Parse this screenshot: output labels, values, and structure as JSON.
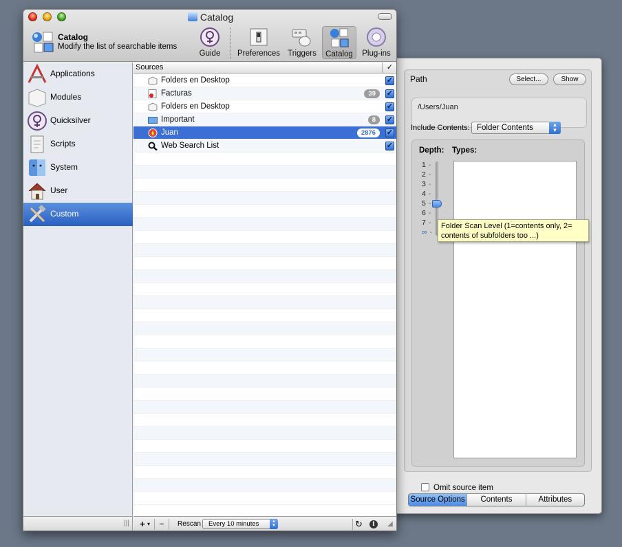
{
  "window": {
    "title": "Catalog"
  },
  "header": {
    "title": "Catalog",
    "subtitle": "Modify the list of searchable items"
  },
  "toolbar": [
    {
      "id": "guide",
      "label": "Guide",
      "icon": "guide-icon"
    },
    {
      "id": "preferences",
      "label": "Preferences",
      "icon": "switch-icon"
    },
    {
      "id": "triggers",
      "label": "Triggers",
      "icon": "keyboard-mouse-icon"
    },
    {
      "id": "catalog",
      "label": "Catalog",
      "icon": "catalog-icon",
      "selected": true
    },
    {
      "id": "plugins",
      "label": "Plug-ins",
      "icon": "puzzle-icon"
    }
  ],
  "sidebar": {
    "items": [
      {
        "label": "Applications",
        "icon": "applications-icon"
      },
      {
        "label": "Modules",
        "icon": "modules-icon"
      },
      {
        "label": "Quicksilver",
        "icon": "quicksilver-icon"
      },
      {
        "label": "Scripts",
        "icon": "scripts-icon"
      },
      {
        "label": "System",
        "icon": "finder-icon"
      },
      {
        "label": "User",
        "icon": "home-icon"
      },
      {
        "label": "Custom",
        "icon": "tools-icon",
        "selected": true
      }
    ]
  },
  "sources": {
    "header": "Sources",
    "check_header": "✓",
    "rows": [
      {
        "name": "Folders en Desktop",
        "count": "",
        "icon": "folder-box-icon"
      },
      {
        "name": "Facturas",
        "count": "39",
        "icon": "document-icon"
      },
      {
        "name": "Folders en Desktop",
        "count": "",
        "icon": "folder-box-icon"
      },
      {
        "name": "Important",
        "count": "8",
        "icon": "folder-blue-icon"
      },
      {
        "name": "Juan",
        "count": "2876",
        "icon": "user-folder-icon",
        "selected": true
      },
      {
        "name": "Web Search List",
        "count": "",
        "icon": "magnifier-icon"
      }
    ]
  },
  "bottom_bar": {
    "add": "+",
    "add_menu": "▾",
    "remove": "−",
    "rescan_label": "Rescan",
    "rescan_value": "Every 10 minutes",
    "resize_grip": "|||"
  },
  "options": {
    "path_label": "Path",
    "select_button": "Select...",
    "show_button": "Show",
    "path_value": "/Users/Juan",
    "include_label": "Include Contents:",
    "include_value": "Folder Contents",
    "depth_label": "Depth:",
    "types_label": "Types:",
    "depth_ticks": [
      "1",
      "2",
      "3",
      "4",
      "5",
      "6",
      "7",
      "∞"
    ],
    "depth_value": 5,
    "tooltip": "Folder Scan Level (1=contents only, 2= contents of subfolders too ...)",
    "omit_label": "Omit source item",
    "tabs": [
      "Source Options",
      "Contents",
      "Attributes"
    ],
    "active_tab": "Source Options"
  },
  "colors": {
    "selection": "#3c6fd4",
    "accent": "#2e6ed2"
  }
}
